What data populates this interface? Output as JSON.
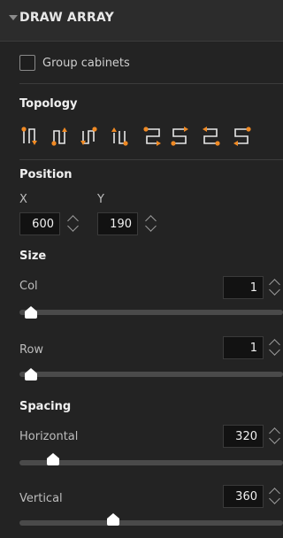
{
  "header": {
    "title": "DRAW ARRAY"
  },
  "group_cabinets": {
    "label": "Group cabinets",
    "checked": false
  },
  "topology": {
    "title": "Topology",
    "icons": [
      "topology-serpentine-1-icon",
      "topology-serpentine-2-icon",
      "topology-serpentine-3-icon",
      "topology-serpentine-4-icon",
      "topology-serpentine-5-icon",
      "topology-serpentine-6-icon",
      "topology-serpentine-7-icon",
      "topology-serpentine-8-icon"
    ],
    "accent": "#f08a24"
  },
  "position": {
    "title": "Position",
    "x_label": "X",
    "x_value": "600",
    "y_label": "Y",
    "y_value": "190"
  },
  "size": {
    "title": "Size",
    "col_label": "Col",
    "col_value": "1",
    "col_slider_level": 0.02,
    "row_label": "Row",
    "row_value": "1",
    "row_slider_level": 0.02
  },
  "spacing": {
    "title": "Spacing",
    "horizontal_label": "Horizontal",
    "horizontal_value": "320",
    "horizontal_slider_level": 0.11,
    "vertical_label": "Vertical",
    "vertical_value": "360",
    "vertical_slider_level": 0.35
  }
}
